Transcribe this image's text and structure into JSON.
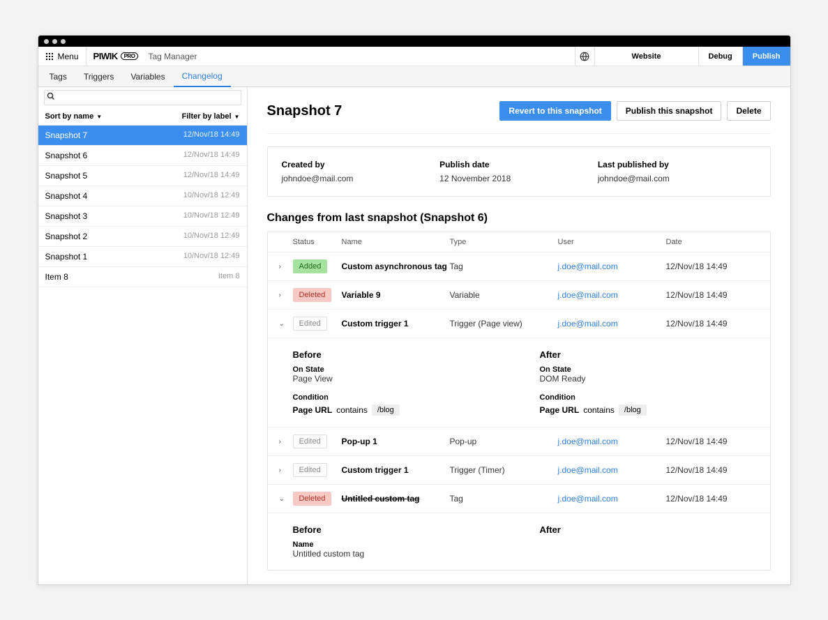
{
  "topbar": {
    "menu_label": "Menu",
    "brand_main": "PIWIK",
    "brand_sub": "PRO",
    "module": "Tag Manager",
    "website_label": "Website",
    "debug_label": "Debug",
    "publish_label": "Publish"
  },
  "tabs": [
    {
      "label": "Tags"
    },
    {
      "label": "Triggers"
    },
    {
      "label": "Variables"
    },
    {
      "label": "Changelog"
    }
  ],
  "sidebar": {
    "sort_label": "Sort by name",
    "filter_label": "Filter by label",
    "items": [
      {
        "name": "Snapshot 7",
        "date": "12/Nov/18 14:49"
      },
      {
        "name": "Snapshot 6",
        "date": "12/Nov/18 14:49"
      },
      {
        "name": "Snapshot 5",
        "date": "12/Nov/18 14:49"
      },
      {
        "name": "Snapshot 4",
        "date": "10/Nov/18 12:49"
      },
      {
        "name": "Snapshot 3",
        "date": "10/Nov/18 12:49"
      },
      {
        "name": "Snapshot 2",
        "date": "10/Nov/18 12:49"
      },
      {
        "name": "Snapshot 1",
        "date": "10/Nov/18 12:49"
      },
      {
        "name": "Item 8",
        "date": "Item 8"
      }
    ]
  },
  "page": {
    "title": "Snapshot 7",
    "revert_btn": "Revert to this snapshot",
    "publish_btn": "Publish this snapshot",
    "delete_btn": "Delete"
  },
  "meta": {
    "created_by_label": "Created by",
    "created_by_val": "johndoe@mail.com",
    "publish_date_label": "Publish date",
    "publish_date_val": "12 November 2018",
    "last_published_label": "Last published by",
    "last_published_val": "johndoe@mail.com"
  },
  "changes": {
    "title": "Changes from last snapshot (Snapshot 6)",
    "headers": {
      "status": "Status",
      "name": "Name",
      "type": "Type",
      "user": "User",
      "date": "Date"
    },
    "rows": [
      {
        "chev": "right",
        "status": "Added",
        "status_class": "added",
        "name": "Custom asynchronous tag",
        "type": "Tag",
        "user": "j.doe@mail.com",
        "date": "12/Nov/18 14:49"
      },
      {
        "chev": "right",
        "status": "Deleted",
        "status_class": "deleted",
        "name": "Variable 9",
        "type": "Variable",
        "user": "j.doe@mail.com",
        "date": "12/Nov/18 14:49"
      },
      {
        "chev": "down",
        "status": "Edited",
        "status_class": "edited",
        "name": "Custom trigger 1",
        "type": "Trigger (Page view)",
        "user": "j.doe@mail.com",
        "date": "12/Nov/18 14:49"
      },
      {
        "chev": "right",
        "status": "Edited",
        "status_class": "edited",
        "name": "Pop-up 1",
        "type": "Pop-up",
        "user": "j.doe@mail.com",
        "date": "12/Nov/18 14:49"
      },
      {
        "chev": "right",
        "status": "Edited",
        "status_class": "edited",
        "name": "Custom trigger 1",
        "type": "Trigger (Timer)",
        "user": "j.doe@mail.com",
        "date": "12/Nov/18 14:49"
      },
      {
        "chev": "down",
        "status": "Deleted",
        "status_class": "deleted",
        "name": "Untitled custom tag",
        "strike": true,
        "type": "Tag",
        "user": "j.doe@mail.com",
        "date": "12/Nov/18 14:49"
      }
    ],
    "detail1": {
      "before_title": "Before",
      "after_title": "After",
      "onstate_label": "On State",
      "before_onstate": "Page View",
      "after_onstate": "DOM Ready",
      "condition_label": "Condition",
      "cond_subject": "Page URL",
      "cond_op": "contains",
      "cond_chip": "/blog"
    },
    "detail2": {
      "before_title": "Before",
      "after_title": "After",
      "name_label": "Name",
      "name_val": "Untitled custom tag"
    }
  }
}
